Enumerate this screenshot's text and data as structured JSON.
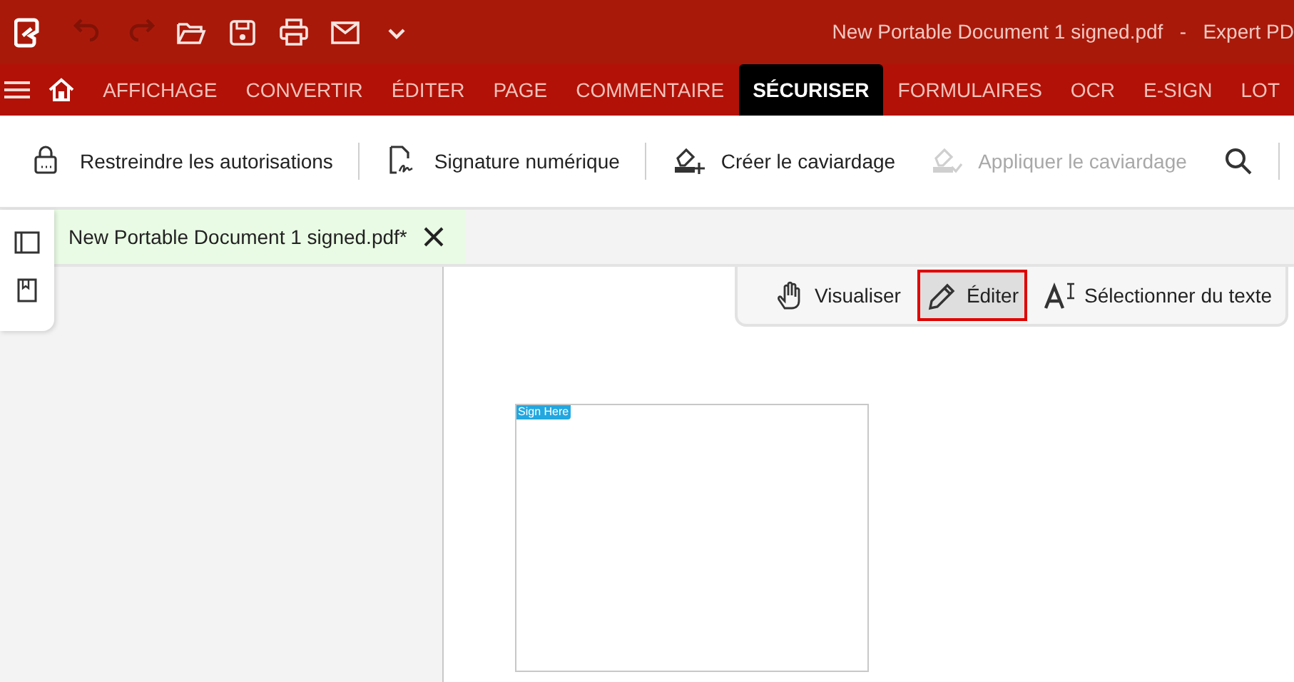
{
  "title_bar": {
    "quick_access": [
      {
        "disabled": true
      },
      {
        "disabled": true
      },
      {
        "disabled": false
      },
      {
        "disabled": false
      },
      {
        "disabled": false
      },
      {
        "disabled": false
      },
      {
        "disabled": false
      }
    ],
    "title": "New Portable Document 1 signed.pdf   -   Expert PD"
  },
  "ribbon_tabs": [
    {
      "label": "AFFICHAGE",
      "selected": false
    },
    {
      "label": "CONVERTIR",
      "selected": false
    },
    {
      "label": "ÉDITER",
      "selected": false
    },
    {
      "label": "PAGE",
      "selected": false
    },
    {
      "label": "COMMENTAIRE",
      "selected": false
    },
    {
      "label": "SÉCURISER",
      "selected": true
    },
    {
      "label": "FORMULAIRES",
      "selected": false
    },
    {
      "label": "OCR",
      "selected": false
    },
    {
      "label": "E-SIGN",
      "selected": false
    },
    {
      "label": "LOT",
      "selected": false
    }
  ],
  "toolbar": [
    {
      "label": "Restreindre les autorisations",
      "disabled": false
    },
    {
      "label": "Signature numérique",
      "disabled": false
    },
    {
      "label": "Créer le caviardage",
      "disabled": false
    },
    {
      "label": "Appliquer le caviardage",
      "disabled": true
    }
  ],
  "document_tab": {
    "label": "New Portable Document 1 signed.pdf*",
    "selected": true
  },
  "modes": [
    {
      "label": "Visualiser",
      "selected": false
    },
    {
      "label": "Éditer",
      "selected": true
    },
    {
      "label": "Sélectionner du texte",
      "selected": false
    }
  ],
  "signature_field": {
    "label": "Sign Here"
  }
}
